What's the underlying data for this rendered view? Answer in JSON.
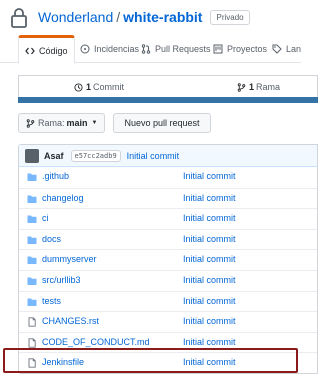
{
  "repo": {
    "owner": "Wonderland",
    "separator": "/",
    "name": "white-rabbit",
    "visibility_badge": "Privado"
  },
  "tabs": [
    {
      "label": "Código",
      "icon": "code-icon",
      "active": true
    },
    {
      "label": "Incidencias",
      "icon": "issue-icon",
      "active": false
    },
    {
      "label": "Pull Requests",
      "icon": "pull-request-icon",
      "active": false
    },
    {
      "label": "Proyectos",
      "icon": "project-icon",
      "active": false
    },
    {
      "label": "Lan",
      "icon": "tag-icon",
      "active": false
    }
  ],
  "summary": {
    "commits_count": "1",
    "commits_label": "Commit",
    "branches_count": "1",
    "branches_label": "Rama"
  },
  "toolbar": {
    "branch_label": "Rama:",
    "branch_value": "main",
    "new_pr_label": "Nuevo pull request"
  },
  "last_commit": {
    "author": "Asaf",
    "sha": "e57cc2adb9",
    "message": "Initial commit"
  },
  "files": [
    {
      "name": ".github",
      "type": "folder",
      "message": "Initial commit"
    },
    {
      "name": "changelog",
      "type": "folder",
      "message": "Initial commit"
    },
    {
      "name": "ci",
      "type": "folder",
      "message": "Initial commit"
    },
    {
      "name": "docs",
      "type": "folder",
      "message": "Initial commit"
    },
    {
      "name": "dummyserver",
      "type": "folder",
      "message": "Initial commit"
    },
    {
      "name": "src/urllib3",
      "type": "folder",
      "message": "Initial commit"
    },
    {
      "name": "tests",
      "type": "folder",
      "message": "Initial commit"
    },
    {
      "name": "CHANGES.rst",
      "type": "file",
      "message": "Initial commit"
    },
    {
      "name": "CODE_OF_CONDUCT.md",
      "type": "file",
      "message": "Initial commit"
    },
    {
      "name": "Jenkinsfile",
      "type": "file",
      "message": "Initial commit"
    }
  ],
  "colors": {
    "link": "#0366d6",
    "folder": "#79b8ff",
    "active_tab_accent": "#e36209",
    "language_bar": "#3572a5",
    "highlight_box": "#8b1a1a"
  }
}
